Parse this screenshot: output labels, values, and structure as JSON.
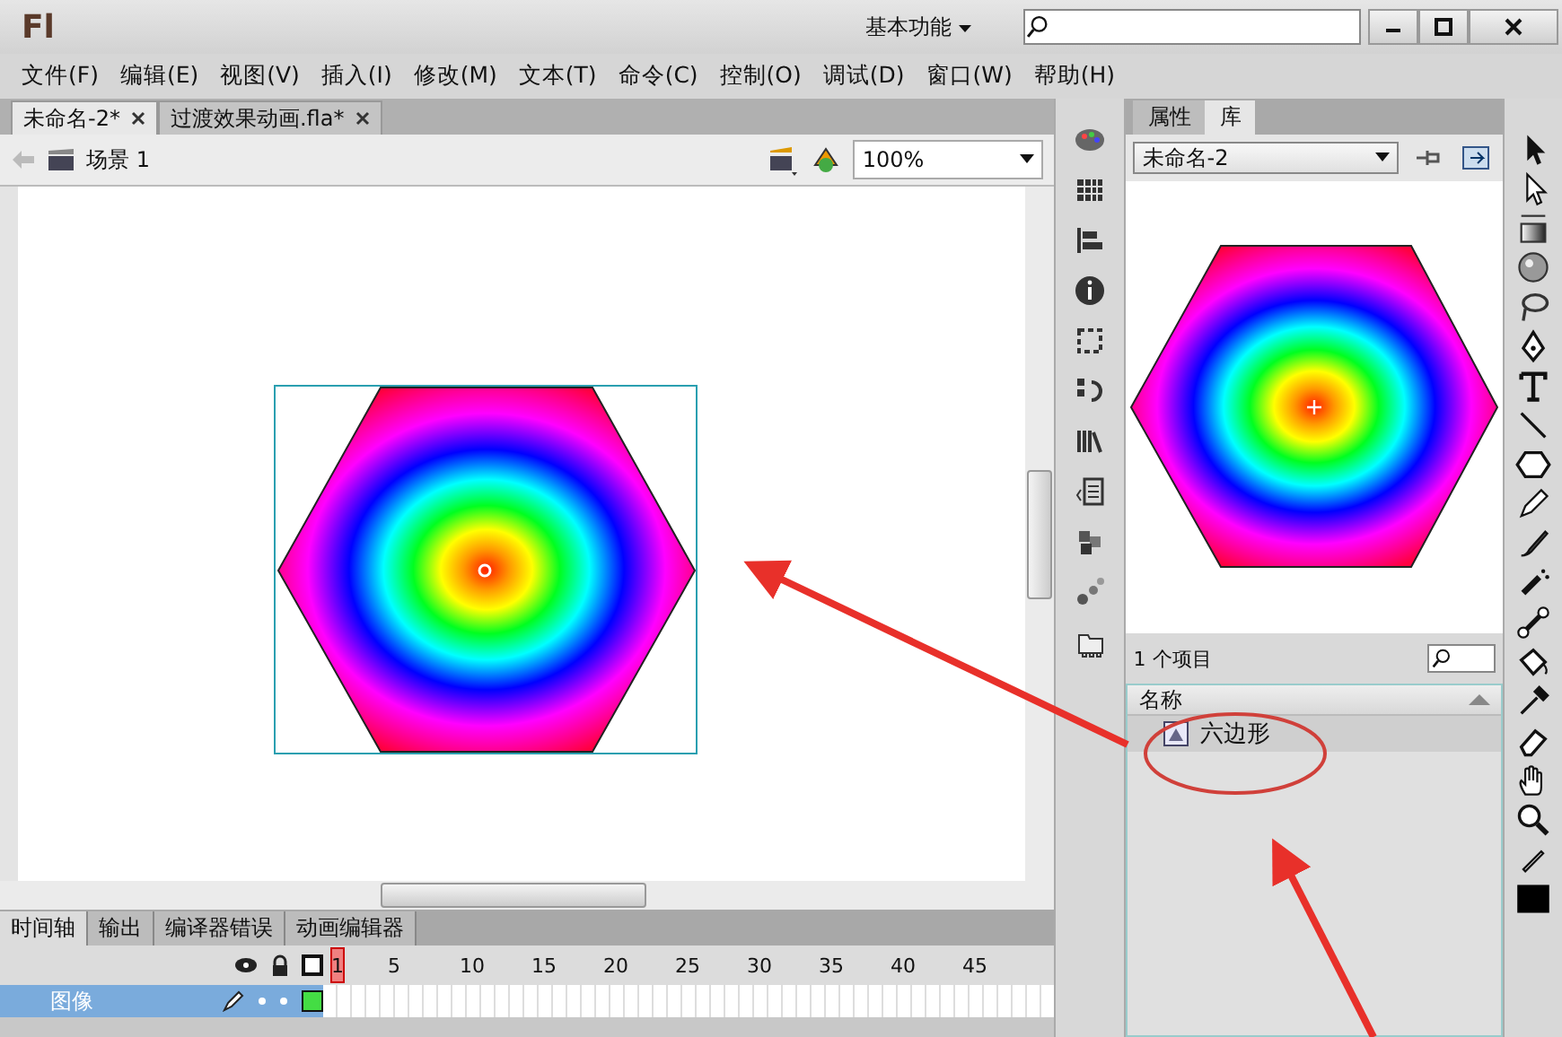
{
  "title_bar": {
    "logo": "Fl",
    "workspace": "基本功能"
  },
  "menu": [
    "文件(F)",
    "编辑(E)",
    "视图(V)",
    "插入(I)",
    "修改(M)",
    "文本(T)",
    "命令(C)",
    "控制(O)",
    "调试(D)",
    "窗口(W)",
    "帮助(H)"
  ],
  "doc_tabs": [
    {
      "label": "未命名-2*",
      "selected": true
    },
    {
      "label": "过渡效果动画.fla*",
      "selected": false
    }
  ],
  "scene": {
    "label": "场景 1",
    "zoom": "100%"
  },
  "library": {
    "tabs": [
      {
        "label": "属性",
        "selected": false
      },
      {
        "label": "库",
        "selected": true
      }
    ],
    "document": "未命名-2",
    "count": "1 个项目",
    "column": "名称",
    "items": [
      {
        "name": "六边形",
        "selected": true
      }
    ]
  },
  "timeline": {
    "tabs": [
      {
        "label": "时间轴",
        "selected": true
      },
      {
        "label": "输出",
        "selected": false
      },
      {
        "label": "编译器错误",
        "selected": false
      },
      {
        "label": "动画编辑器",
        "selected": false
      }
    ],
    "frames": [
      {
        "label": "1",
        "selected": true
      },
      {
        "label": "5",
        "selected": false
      },
      {
        "label": "10",
        "selected": false
      },
      {
        "label": "15",
        "selected": false
      },
      {
        "label": "20",
        "selected": false
      },
      {
        "label": "25",
        "selected": false
      },
      {
        "label": "30",
        "selected": false
      },
      {
        "label": "35",
        "selected": false
      },
      {
        "label": "40",
        "selected": false
      },
      {
        "label": "45",
        "selected": false
      }
    ],
    "layers": [
      {
        "name": "图像",
        "selected": true
      }
    ]
  }
}
